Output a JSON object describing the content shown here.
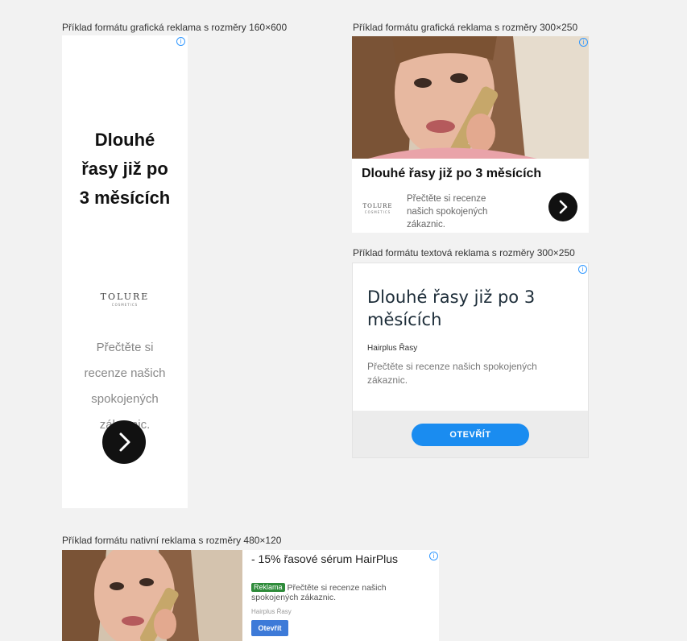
{
  "captions": {
    "skyscraper": "Příklad formátu grafická reklama s rozměry 160×600",
    "rectangle": "Příklad formátu grafická reklama s rozměry 300×250",
    "text": "Příklad formátu textová reklama s rozměry 300×250",
    "native": "Příklad formátu nativní reklama s rozměry 480×120"
  },
  "skyscraper_ad": {
    "headline_lines": [
      "Dlouhé",
      "řasy již po",
      "3 měsících"
    ],
    "logo": "TOLURE",
    "logo_sub": "COSMETICS",
    "description_lines": [
      "Přečtěte si",
      "recenze našich",
      "spokojených",
      "zákaznic."
    ],
    "button_icon": "chevron-right-icon"
  },
  "rectangle_ad": {
    "headline": "Dlouhé řasy již po 3 měsících",
    "logo": "TOLURE",
    "logo_sub": "COSMETICS",
    "description": "Přečtěte si recenze našich spokojených zákaznic.",
    "button_icon": "chevron-right-icon"
  },
  "text_ad": {
    "headline": "Dlouhé řasy již po 3 měsících",
    "advertiser": "Hairplus Řasy",
    "description": "Přečtěte si recenze našich spokojených zákaznic.",
    "cta": "OTEVŘÍT"
  },
  "native_ad": {
    "title": "- 15% řasové sérum HairPlus",
    "badge": "Reklama",
    "description": "Přečtěte si recenze našich spokojených zákaznic.",
    "advertiser": "Hairplus Řasy",
    "cta": "Otevřít"
  },
  "info_icon": "i",
  "colors": {
    "page_bg": "#f2f2f2",
    "cta_blue": "#1a8cf0",
    "native_button": "#3d7ad8",
    "badge_green": "#2e8b3a",
    "info_blue": "#3399ff"
  }
}
